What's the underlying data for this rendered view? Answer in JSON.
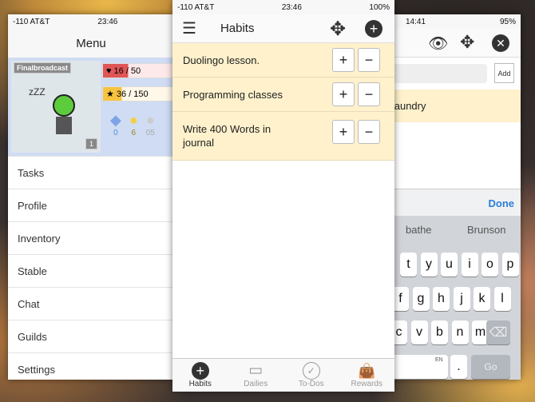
{
  "left": {
    "status": {
      "carrier": "-110 AT&T",
      "time": "23:46"
    },
    "title": "Menu",
    "profile": {
      "username": "Finalbroadcast",
      "health": "16 / 50",
      "health_fraction": 0.32,
      "experience": "36 / 150",
      "exp_fraction": 0.24,
      "gems": "0",
      "gold": "6",
      "silver": "05",
      "level": "1",
      "sleep": "zZZ"
    },
    "items": [
      "Tasks",
      "Profile",
      "Inventory",
      "Stable",
      "Chat",
      "Guilds",
      "Settings"
    ]
  },
  "mid": {
    "status": {
      "carrier": "-110 AT&T",
      "time": "23:46",
      "battery": "100%"
    },
    "title": "Habits",
    "habits": [
      "Duolingo lesson.",
      "Programming classes",
      "Write 400 Words in journal"
    ],
    "tabs": [
      "Habits",
      "Dailies",
      "To-Dos",
      "Rewards"
    ],
    "accent": "#333333",
    "habit_bg": "#fef1cc"
  },
  "right": {
    "status": {
      "time": "14:41",
      "battery": "95%"
    },
    "add_label": "Add",
    "task_text": "n laundry",
    "done_label": "Done",
    "suggestions": [
      "bathe",
      "Brunson"
    ],
    "keys_row1": [
      "t",
      "y",
      "u",
      "i",
      "o",
      "p"
    ],
    "keys_row2": [
      "f",
      "g",
      "h",
      "j",
      "k",
      "l"
    ],
    "keys_row3": [
      "c",
      "v",
      "b",
      "n",
      "m"
    ],
    "lang": "EN",
    "period": ".",
    "go": "Go"
  }
}
